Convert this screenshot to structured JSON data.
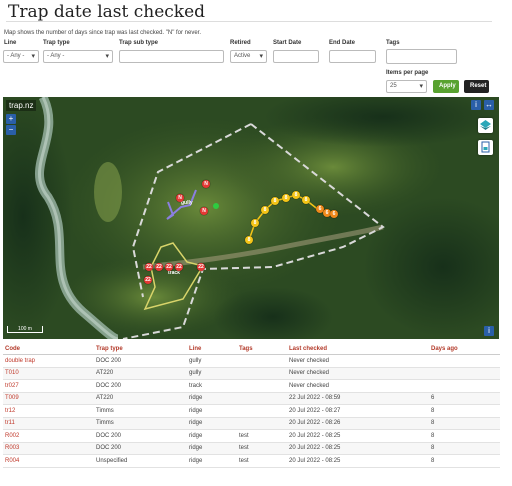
{
  "page": {
    "title": "Trap date last checked",
    "description": "Map shows the number of days since trap was last checked. \"N\" for never."
  },
  "filters": {
    "line": {
      "label": "Line",
      "value": "- Any -"
    },
    "trap_type": {
      "label": "Trap type",
      "value": "- Any -"
    },
    "trap_sub_type": {
      "label": "Trap sub type",
      "value": ""
    },
    "retired": {
      "label": "Retired",
      "value": "Active"
    },
    "start_date": {
      "label": "Start Date",
      "value": ""
    },
    "end_date": {
      "label": "End Date",
      "value": ""
    },
    "tags": {
      "label": "Tags",
      "value": ""
    },
    "items_per_page": {
      "label": "Items per page",
      "value": "25"
    },
    "apply_label": "Apply",
    "reset_label": "Reset"
  },
  "map": {
    "logo": "trap.nz",
    "scale_label": "100 m",
    "zoom_in": "+",
    "zoom_out": "−",
    "info": "i",
    "labels": {
      "gully": "gully",
      "track": "track",
      "n1": "N",
      "n2": "N",
      "n3": "N",
      "r1": "22",
      "r2": "22",
      "r3": "22",
      "r4": "22",
      "r5": "22",
      "r6": "22",
      "y1": "8",
      "y2": "8",
      "y3": "8",
      "y4": "8",
      "y5": "8",
      "y6": "8",
      "y7": "8",
      "o1": "6",
      "o2": "6",
      "o3": "6"
    }
  },
  "table": {
    "headers": {
      "code": "Code",
      "trap_type": "Trap type",
      "line": "Line",
      "tags": "Tags",
      "last_checked": "Last checked",
      "days_ago": "Days ago"
    },
    "rows": [
      {
        "code": "double trap",
        "trap_type": "DOC 200",
        "line": "gully",
        "tags": "",
        "last_checked": "Never checked",
        "days_ago": ""
      },
      {
        "code": "T010",
        "trap_type": "AT220",
        "line": "gully",
        "tags": "",
        "last_checked": "Never checked",
        "days_ago": ""
      },
      {
        "code": "tr027",
        "trap_type": "DOC 200",
        "line": "track",
        "tags": "",
        "last_checked": "Never checked",
        "days_ago": ""
      },
      {
        "code": "T009",
        "trap_type": "AT220",
        "line": "ridge",
        "tags": "",
        "last_checked": "22 Jul 2022 - 08:59",
        "days_ago": "6"
      },
      {
        "code": "tr12",
        "trap_type": "Timms",
        "line": "ridge",
        "tags": "",
        "last_checked": "20 Jul 2022 - 08:27",
        "days_ago": "8"
      },
      {
        "code": "tr11",
        "trap_type": "Timms",
        "line": "ridge",
        "tags": "",
        "last_checked": "20 Jul 2022 - 08:26",
        "days_ago": "8"
      },
      {
        "code": "R002",
        "trap_type": "DOC 200",
        "line": "ridge",
        "tags": "test",
        "last_checked": "20 Jul 2022 - 08:25",
        "days_ago": "8"
      },
      {
        "code": "R003",
        "trap_type": "DOC 200",
        "line": "ridge",
        "tags": "test",
        "last_checked": "20 Jul 2022 - 08:25",
        "days_ago": "8"
      },
      {
        "code": "R004",
        "trap_type": "Unspecified",
        "line": "ridge",
        "tags": "test",
        "last_checked": "20 Jul 2022 - 08:25",
        "days_ago": "8"
      }
    ]
  },
  "colors": {
    "never": "#e53935",
    "recent": "#f5c518",
    "older": "#f08a1c",
    "link": "#c0392b",
    "apply": "#58a22f"
  }
}
